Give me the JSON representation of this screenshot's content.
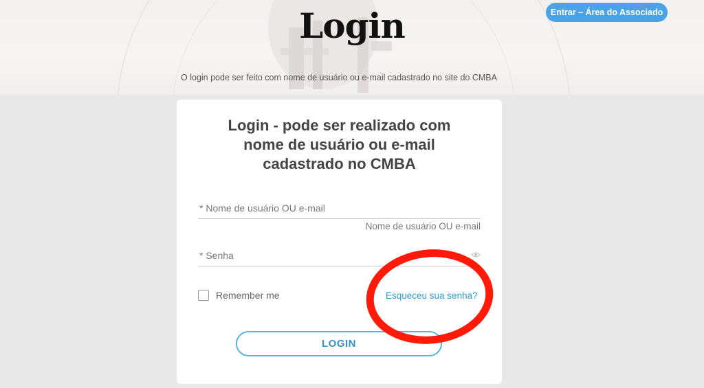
{
  "header": {
    "title": "Login",
    "subtitle": "O login pode ser feito com nome de usuário ou e-mail cadastrado no site do CMBA",
    "associate_button": "Entrar – Área do Associado"
  },
  "card": {
    "heading_lines": [
      "Login - pode ser realizado com",
      "nome de usuário ou e-mail",
      "cadastrado no CMBA"
    ],
    "username": {
      "placeholder": "* Nome de usuário OU e-mail",
      "value": "",
      "hint": "Nome de usuário OU e-mail"
    },
    "password": {
      "placeholder": "* Senha",
      "value": ""
    },
    "remember_label": "Remember me",
    "forgot_link": "Esqueceu sua senha?",
    "login_button": "LOGIN"
  },
  "icons": {
    "show_password": "eye-icon",
    "remember_checkbox": "checkbox-unchecked"
  },
  "colors": {
    "accent": "#2a9fd6",
    "associate_button_bg": "#4aa3e6",
    "annotation": "#ff1a0a",
    "background": "#e8e8e8"
  },
  "annotation": {
    "shape": "ellipse",
    "highlights": "forgot_link"
  }
}
